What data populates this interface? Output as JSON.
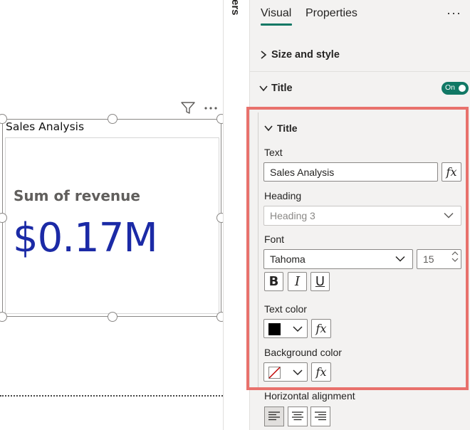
{
  "canvas": {
    "visual_title": "Sales Analysis",
    "card_label": "Sum of revenue",
    "card_value": "$0.17M",
    "card_value_color": "#1b2aa6"
  },
  "filters_pane": {
    "label": "ters"
  },
  "format_pane": {
    "tabs": [
      {
        "label": "Visual",
        "active": true
      },
      {
        "label": "Properties",
        "active": false
      }
    ],
    "more_label": "···",
    "sections": {
      "size_style": {
        "label": "Size and style",
        "expanded": false
      },
      "title": {
        "label": "Title",
        "expanded": true,
        "toggle": "On"
      }
    },
    "title_sub": {
      "header": "Title",
      "text_label": "Text",
      "text_value": "Sales Analysis",
      "fx_label": "fx",
      "heading_label": "Heading",
      "heading_value": "Heading 3",
      "font_label": "Font",
      "font_family": "Tahoma",
      "font_size": "15",
      "bold_label": "B",
      "italic_label": "I",
      "underline_label": "U",
      "text_color_label": "Text color",
      "text_color": "#000000",
      "background_color_label": "Background color",
      "horizontal_alignment_label": "Horizontal alignment"
    },
    "accent_color": "#117865",
    "highlight_color": "#e8716c"
  }
}
